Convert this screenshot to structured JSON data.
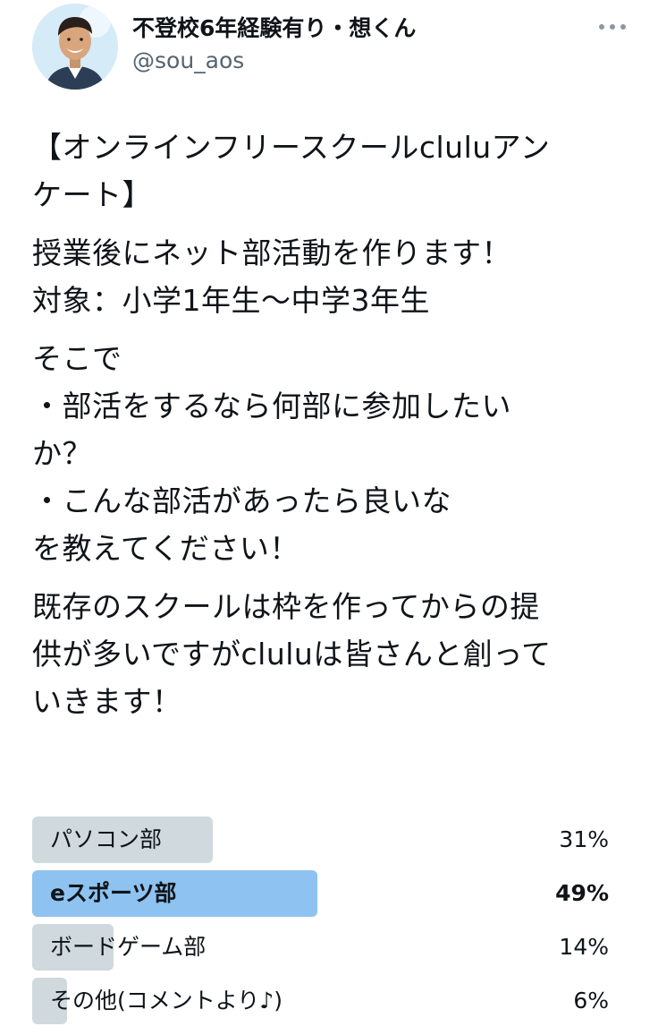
{
  "author": {
    "display_name": "不登校6年経験有り・想くん",
    "handle": "@sou_aos",
    "avatar_icon": "profile-photo"
  },
  "tweet": {
    "paragraphs": [
      [
        "【オンラインフリースクールcluluアン",
        "ケート】"
      ],
      [
        "授業後にネット部活動を作ります！",
        "対象：小学1年生〜中学3年生"
      ],
      [
        "そこで",
        "・部活をするなら何部に参加したい",
        "か？",
        "・こんな部活があったら良いな",
        "を教えてください！"
      ],
      [
        "既存のスクールは枠を作ってからの提",
        "供が多いですがcluluは皆さんと創って",
        "いきます！"
      ]
    ]
  },
  "poll": {
    "options": [
      {
        "label": "パソコン部",
        "percent_text": "31%",
        "percent": 31,
        "winner": false
      },
      {
        "label": "eスポーツ部",
        "percent_text": "49%",
        "percent": 49,
        "winner": true
      },
      {
        "label": "ボードゲーム部",
        "percent_text": "14%",
        "percent": 14,
        "winner": false
      },
      {
        "label": "その他(コメントより♪)",
        "percent_text": "6%",
        "percent": 6,
        "winner": false
      }
    ],
    "colors": {
      "bar": "#cfd9de",
      "winner_bar": "#8ec2f0"
    }
  }
}
